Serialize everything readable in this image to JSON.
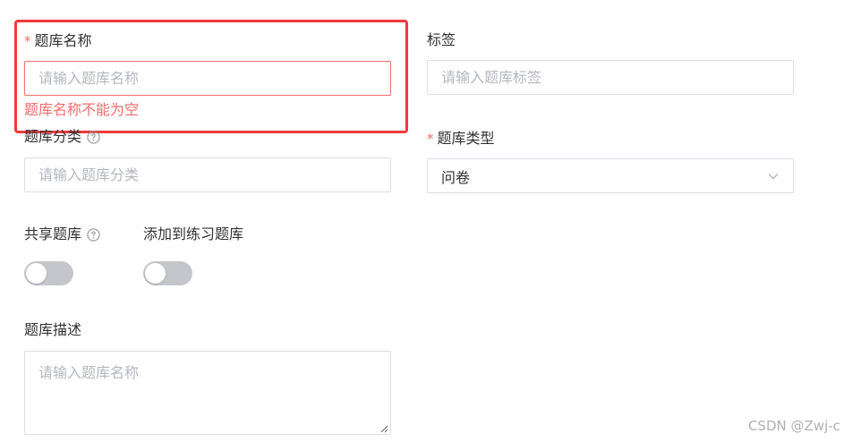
{
  "form": {
    "bank_name": {
      "label": "题库名称",
      "required_mark": "*",
      "placeholder": "请输入题库名称",
      "value": "",
      "error": "题库名称不能为空"
    },
    "tags": {
      "label": "标签",
      "placeholder": "请输入题库标签",
      "value": ""
    },
    "category": {
      "label": "题库分类",
      "placeholder": "请输入题库分类",
      "value": ""
    },
    "bank_type": {
      "label": "题库类型",
      "required_mark": "*",
      "selected": "问卷"
    },
    "shared": {
      "label": "共享题库",
      "on": false
    },
    "add_to_practice": {
      "label": "添加到练习题库",
      "on": false
    },
    "description": {
      "label": "题库描述",
      "placeholder": "请输入题库名称",
      "value": ""
    }
  },
  "icons": {
    "help": "question-circle-icon",
    "dropdown": "chevron-down-icon",
    "resize": "resize-handle-icon"
  },
  "colors": {
    "required": "#f56c6c",
    "error": "#f56c6c",
    "highlight_box": "#f03a3a",
    "switch_off": "#c4c6cc"
  },
  "watermark": "CSDN @Zwj-c"
}
